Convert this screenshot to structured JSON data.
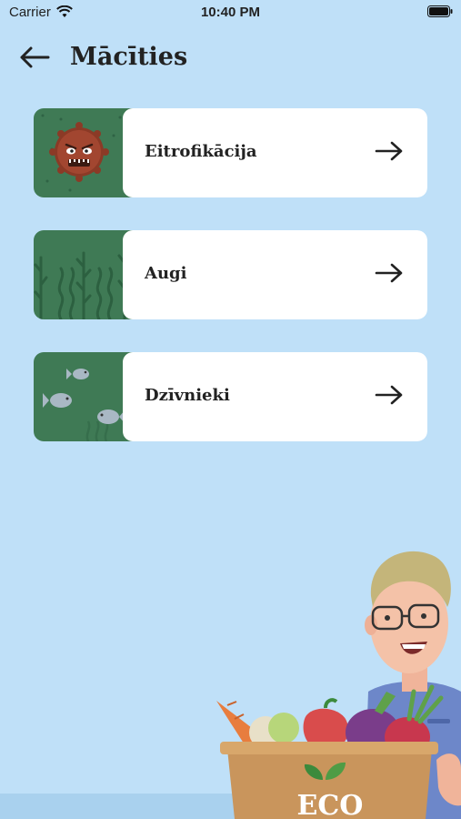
{
  "status_bar": {
    "carrier": "Carrier",
    "time": "10:40 PM"
  },
  "header": {
    "title": "Mācīties",
    "back_icon": "arrow-left-icon"
  },
  "topics": [
    {
      "label": "Eitrofikācija",
      "thumb": "bacteria-illustration"
    },
    {
      "label": "Augi",
      "thumb": "seaweed-illustration"
    },
    {
      "label": "Dzīvnieki",
      "thumb": "fish-illustration"
    }
  ],
  "illustration": {
    "basket_text": "ECO"
  },
  "colors": {
    "background": "#bfe0f8",
    "card_green": "#3f7a55",
    "card": "#ffffff"
  }
}
